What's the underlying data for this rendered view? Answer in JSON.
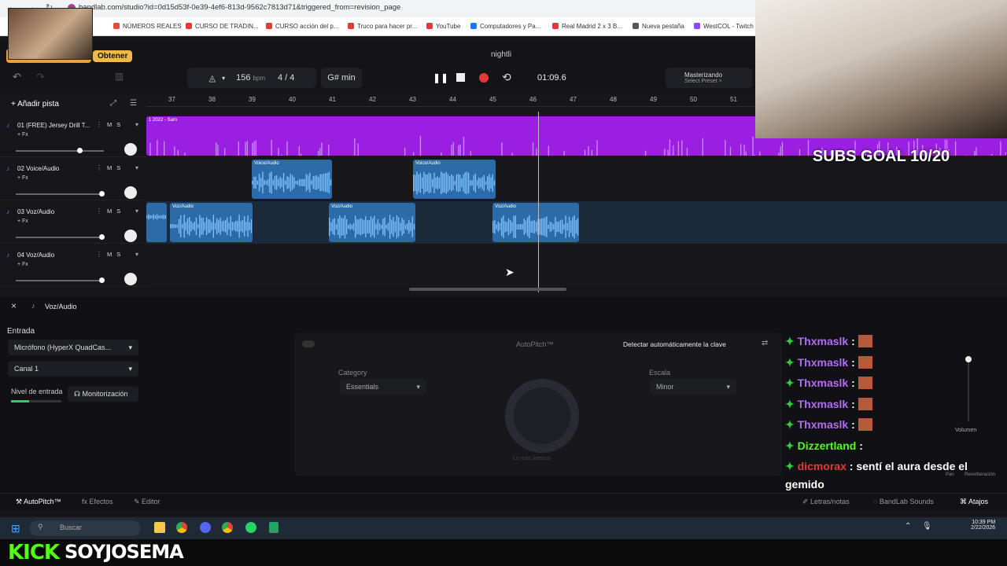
{
  "browser": {
    "url": "bandlab.com/studio?id=0d15d53f-0e39-4ef6-813d-9562c7813d71&triggered_from=revision_page",
    "bookmarks": [
      {
        "label": "NÚMEROS REALES",
        "color": "#e74c3c"
      },
      {
        "label": "CURSO DE TRADIN...",
        "color": "#e53935"
      },
      {
        "label": "CURSO acción del p...",
        "color": "#e53935"
      },
      {
        "label": "Truco para hacer pr...",
        "color": "#e53935"
      },
      {
        "label": "YouTube",
        "color": "#e53935"
      },
      {
        "label": "Computadores y Pa...",
        "color": "#1877f2"
      },
      {
        "label": "Real Madrid 2 x 3 B...",
        "color": "#e53935"
      },
      {
        "label": "Nueva pestaña",
        "color": "#555555"
      },
      {
        "label": "WestCOL - Twitch",
        "color": "#9146ff"
      }
    ]
  },
  "header": {
    "project": "nightli",
    "get_label": "Obtener",
    "bpm": "156",
    "bpm_unit": "bpm",
    "time_sig": "4 / 4",
    "key": "G# min",
    "time": "01:09.6",
    "mastering": "Masterizando",
    "preset": "Select Preset >"
  },
  "tracks": {
    "add_label": "Añadir pista",
    "items": [
      {
        "name": "01 (FREE) Jersey Drill T...",
        "fx": "+ Fx",
        "m": "M",
        "s": "S"
      },
      {
        "name": "02 Voice/Audio",
        "fx": "+ Fx",
        "m": "M",
        "s": "S"
      },
      {
        "name": "03 Voz/Audio",
        "fx": "+ Fx",
        "m": "M",
        "s": "S"
      },
      {
        "name": "04 Voz/Audio",
        "fx": "+ Fx",
        "m": "M",
        "s": "S"
      }
    ]
  },
  "ruler": {
    "bars": [
      "37",
      "38",
      "39",
      "40",
      "41",
      "42",
      "43",
      "44",
      "45",
      "46",
      "47",
      "48",
      "49",
      "50",
      "51"
    ]
  },
  "clips": {
    "beat_label": "1 2022 - Sam",
    "voice_label": "Voice/Audio",
    "voz_label": "Voz/Audio"
  },
  "panel": {
    "title": "Voz/Audio",
    "input_label": "Entrada",
    "mic": "Micrófono (HyperX QuadCas...",
    "channel": "Canal 1",
    "level_label": "Nivel de entrada",
    "monitor": "Monitorización",
    "autopitch_title": "AutoPitch™",
    "detect": "Detectar automáticamente la clave",
    "category_label": "Category",
    "category": "Essentials",
    "scale_label": "Escala",
    "scale": "Minor",
    "dial_label": "Lo más intenso",
    "volume_label": "Volumen",
    "pan_label": "Pan",
    "reverb_label": "Reverberación"
  },
  "bottom_tabs": {
    "autopitch": "AutoPitch™",
    "effects": "Efectos",
    "editor": "Editor",
    "lyrics": "Letras/notas",
    "sounds": "BandLab Sounds",
    "shortcuts": "Atajos"
  },
  "taskbar": {
    "search": "Buscar",
    "time": "10:39 PM",
    "date": "2/22/2026"
  },
  "stream": {
    "kick": "KICK",
    "username": "SOYJOSEMA",
    "subs_goal": "SUBS GOAL 10/20"
  },
  "chat": [
    {
      "user": "Thxmaslk",
      "color": "#b36ef0",
      "text": ":"
    },
    {
      "user": "Thxmaslk",
      "color": "#b36ef0",
      "text": ":"
    },
    {
      "user": "Thxmaslk",
      "color": "#b36ef0",
      "text": ":"
    },
    {
      "user": "Thxmaslk",
      "color": "#b36ef0",
      "text": ":"
    },
    {
      "user": "Thxmaslk",
      "color": "#b36ef0",
      "text": ":"
    },
    {
      "user": "Dizzertland",
      "color": "#53fc18",
      "text": ":"
    },
    {
      "user": "dicmorax",
      "color": "#e53935",
      "text": ": sentí el aura desde el"
    },
    {
      "user": "",
      "color": "#ffffff",
      "text": "gemido"
    }
  ]
}
